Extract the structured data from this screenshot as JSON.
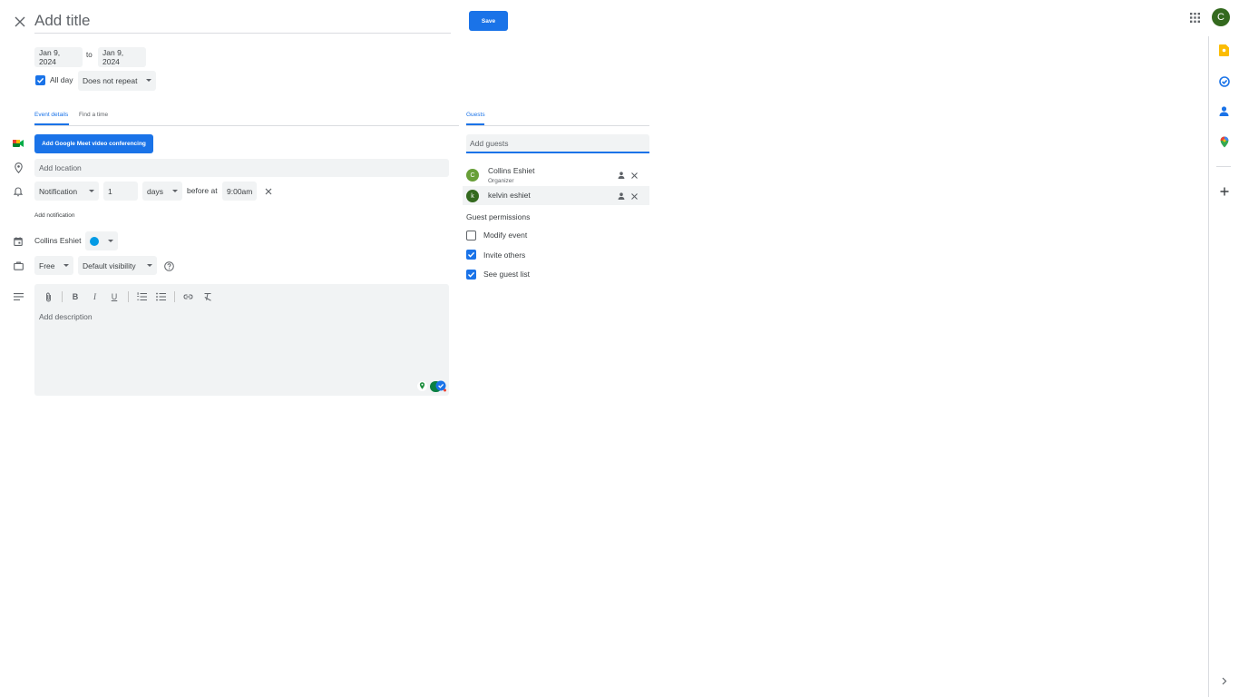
{
  "header": {
    "title_placeholder": "Add title",
    "save_label": "Save",
    "account_initial": "C"
  },
  "dates": {
    "start": "Jan 9, 2024",
    "separator": "to",
    "end": "Jan 9, 2024",
    "all_day_label": "All day",
    "all_day_checked": true,
    "repeat": "Does not repeat"
  },
  "tabs": {
    "event_details": "Event details",
    "find_time": "Find a time",
    "guests": "Guests"
  },
  "event": {
    "meet_button": "Add Google Meet video conferencing",
    "location_placeholder": "Add location",
    "notification": {
      "type": "Notification",
      "amount": "1",
      "unit": "days",
      "before_at": "before at",
      "time": "9:00am"
    },
    "add_notification": "Add notification",
    "calendar_owner": "Collins Eshiet",
    "calendar_color": "#039be5",
    "availability": "Free",
    "visibility": "Default visibility",
    "description_placeholder": "Add description"
  },
  "guests": {
    "input_placeholder": "Add guests",
    "list": [
      {
        "initial": "C",
        "name": "Collins Eshiet",
        "role": "Organizer",
        "color": "#689f38"
      },
      {
        "initial": "k",
        "name": "kelvin eshiet",
        "role": "",
        "color": "#33691e"
      }
    ],
    "permissions_title": "Guest permissions",
    "permissions": [
      {
        "label": "Modify event",
        "checked": false
      },
      {
        "label": "Invite others",
        "checked": true
      },
      {
        "label": "See guest list",
        "checked": true
      }
    ]
  },
  "colors": {
    "accent": "#1a73e8",
    "field_bg": "#f1f3f4"
  }
}
